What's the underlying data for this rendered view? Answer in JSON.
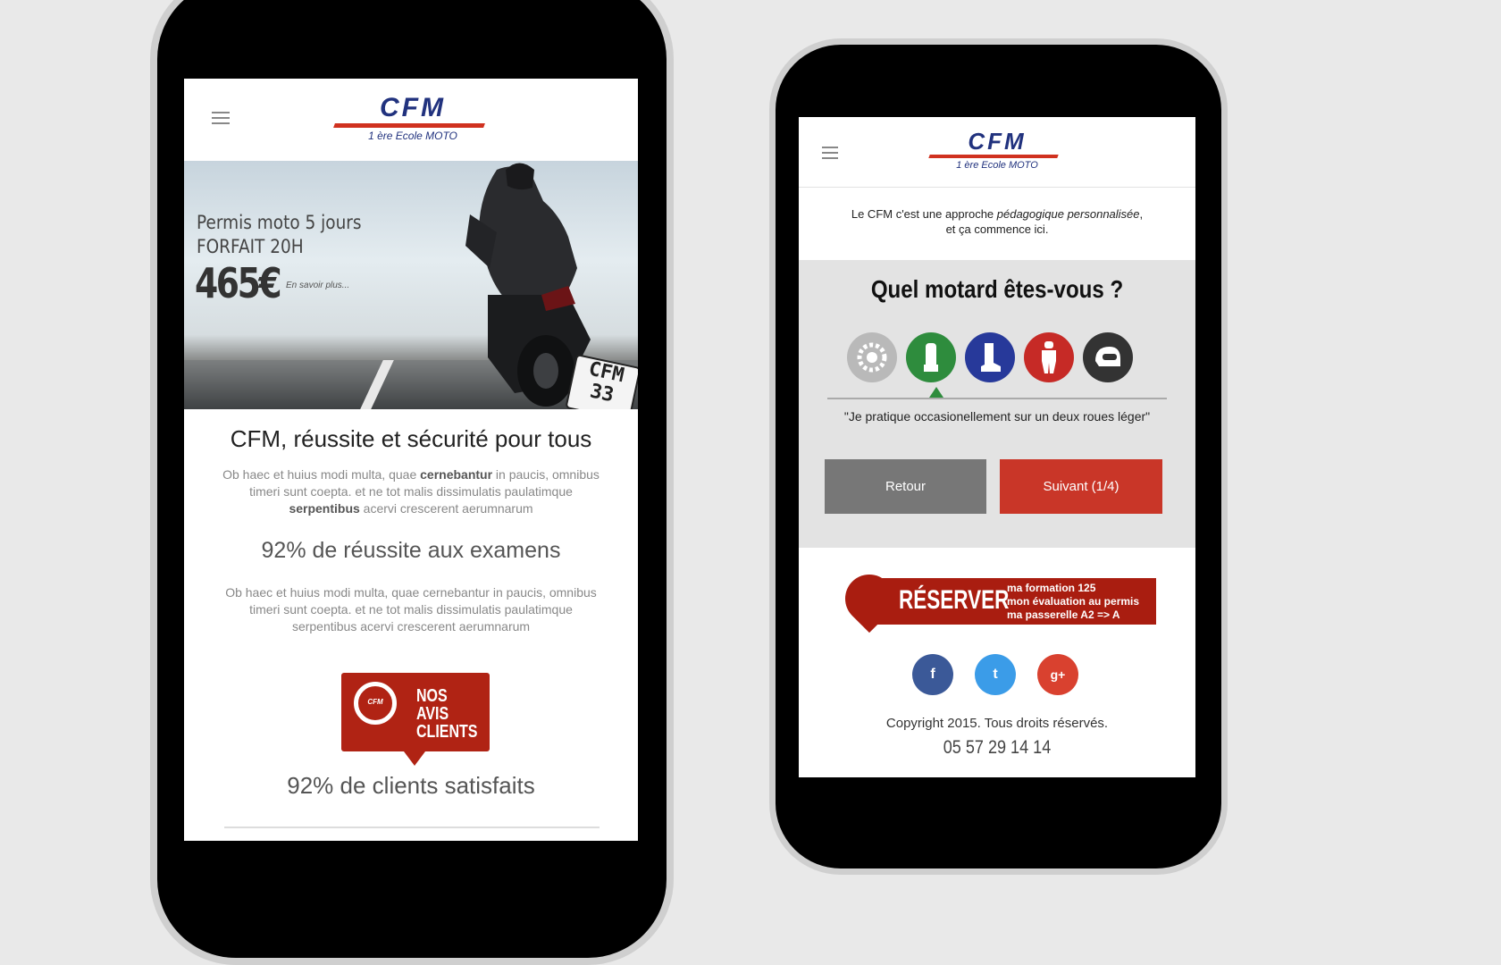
{
  "colors": {
    "brand_blue": "#21327e",
    "brand_red": "#b02314",
    "button_grey": "#777777",
    "button_red": "#c93628"
  },
  "left_phone": {
    "menu_icon": "hamburger-icon",
    "logo": {
      "word": "CFM",
      "sub": "1 ère Ecole MOTO"
    },
    "hero": {
      "line1": "Permis moto 5 jours",
      "line2": "FORFAIT 20H",
      "price": "465€",
      "more": "En savoir plus...",
      "plate_line1": "CFM",
      "plate_line2": "33"
    },
    "headline": "CFM, réussite et sécurité pour tous",
    "para1": {
      "a": "Ob haec et huius modi multa, quae ",
      "b": "cernebantur",
      "c": " in paucis, omnibus timeri sunt coepta. et ne tot malis dissimulatis paulatimque ",
      "d": "serpentibus",
      "e": " acervi crescerent  aerumnarum"
    },
    "stat1": "92% de réussite aux examens",
    "para2": "Ob haec et huius modi multa, quae cernebantur in paucis, omnibus timeri sunt coepta. et ne tot malis dissimulatis paulatimque serpentibus acervi crescerent  aerumnarum",
    "avis": {
      "badge": "CFM",
      "line1": "NOS AVIS",
      "line2": "CLIENTS"
    },
    "stat2": "92% de clients satisfaits"
  },
  "right_phone": {
    "menu_icon": "hamburger-icon",
    "logo": {
      "word": "CFM",
      "sub": "1 ère Ecole MOTO"
    },
    "intro_a": "Le CFM c'est une approche ",
    "intro_em": "pédagogique personnalisée",
    "intro_b": ",",
    "intro_line2": "et ça commence ici.",
    "quiz": {
      "title": "Quel motard êtes-vous ?",
      "choices": [
        {
          "icon": "gear-icon",
          "color": "#b9b9b9"
        },
        {
          "icon": "glove-icon",
          "color": "#2e8c3d"
        },
        {
          "icon": "boot-icon",
          "color": "#27399a"
        },
        {
          "icon": "suit-icon",
          "color": "#c62a26"
        },
        {
          "icon": "helmet-icon",
          "color": "#333333"
        }
      ],
      "selected_index": 1,
      "quote": "\"Je pratique occasionellement sur un deux roues léger\"",
      "back_label": "Retour",
      "next_label": "Suivant (1/4)"
    },
    "reserver": {
      "word": "RÉSERVER",
      "line1": "ma formation 125",
      "line2": "mon évaluation au permis",
      "line3": "ma passerelle A2 => A"
    },
    "social": [
      {
        "icon": "facebook-icon",
        "glyph": "f",
        "color": "#3b5998"
      },
      {
        "icon": "twitter-icon",
        "glyph": "t",
        "color": "#3b9ce8"
      },
      {
        "icon": "google-plus-icon",
        "glyph": "g+",
        "color": "#d9412f"
      }
    ],
    "copyright": "Copyright 2015. Tous droits réservés.",
    "phone": "05 57 29 14 14"
  }
}
